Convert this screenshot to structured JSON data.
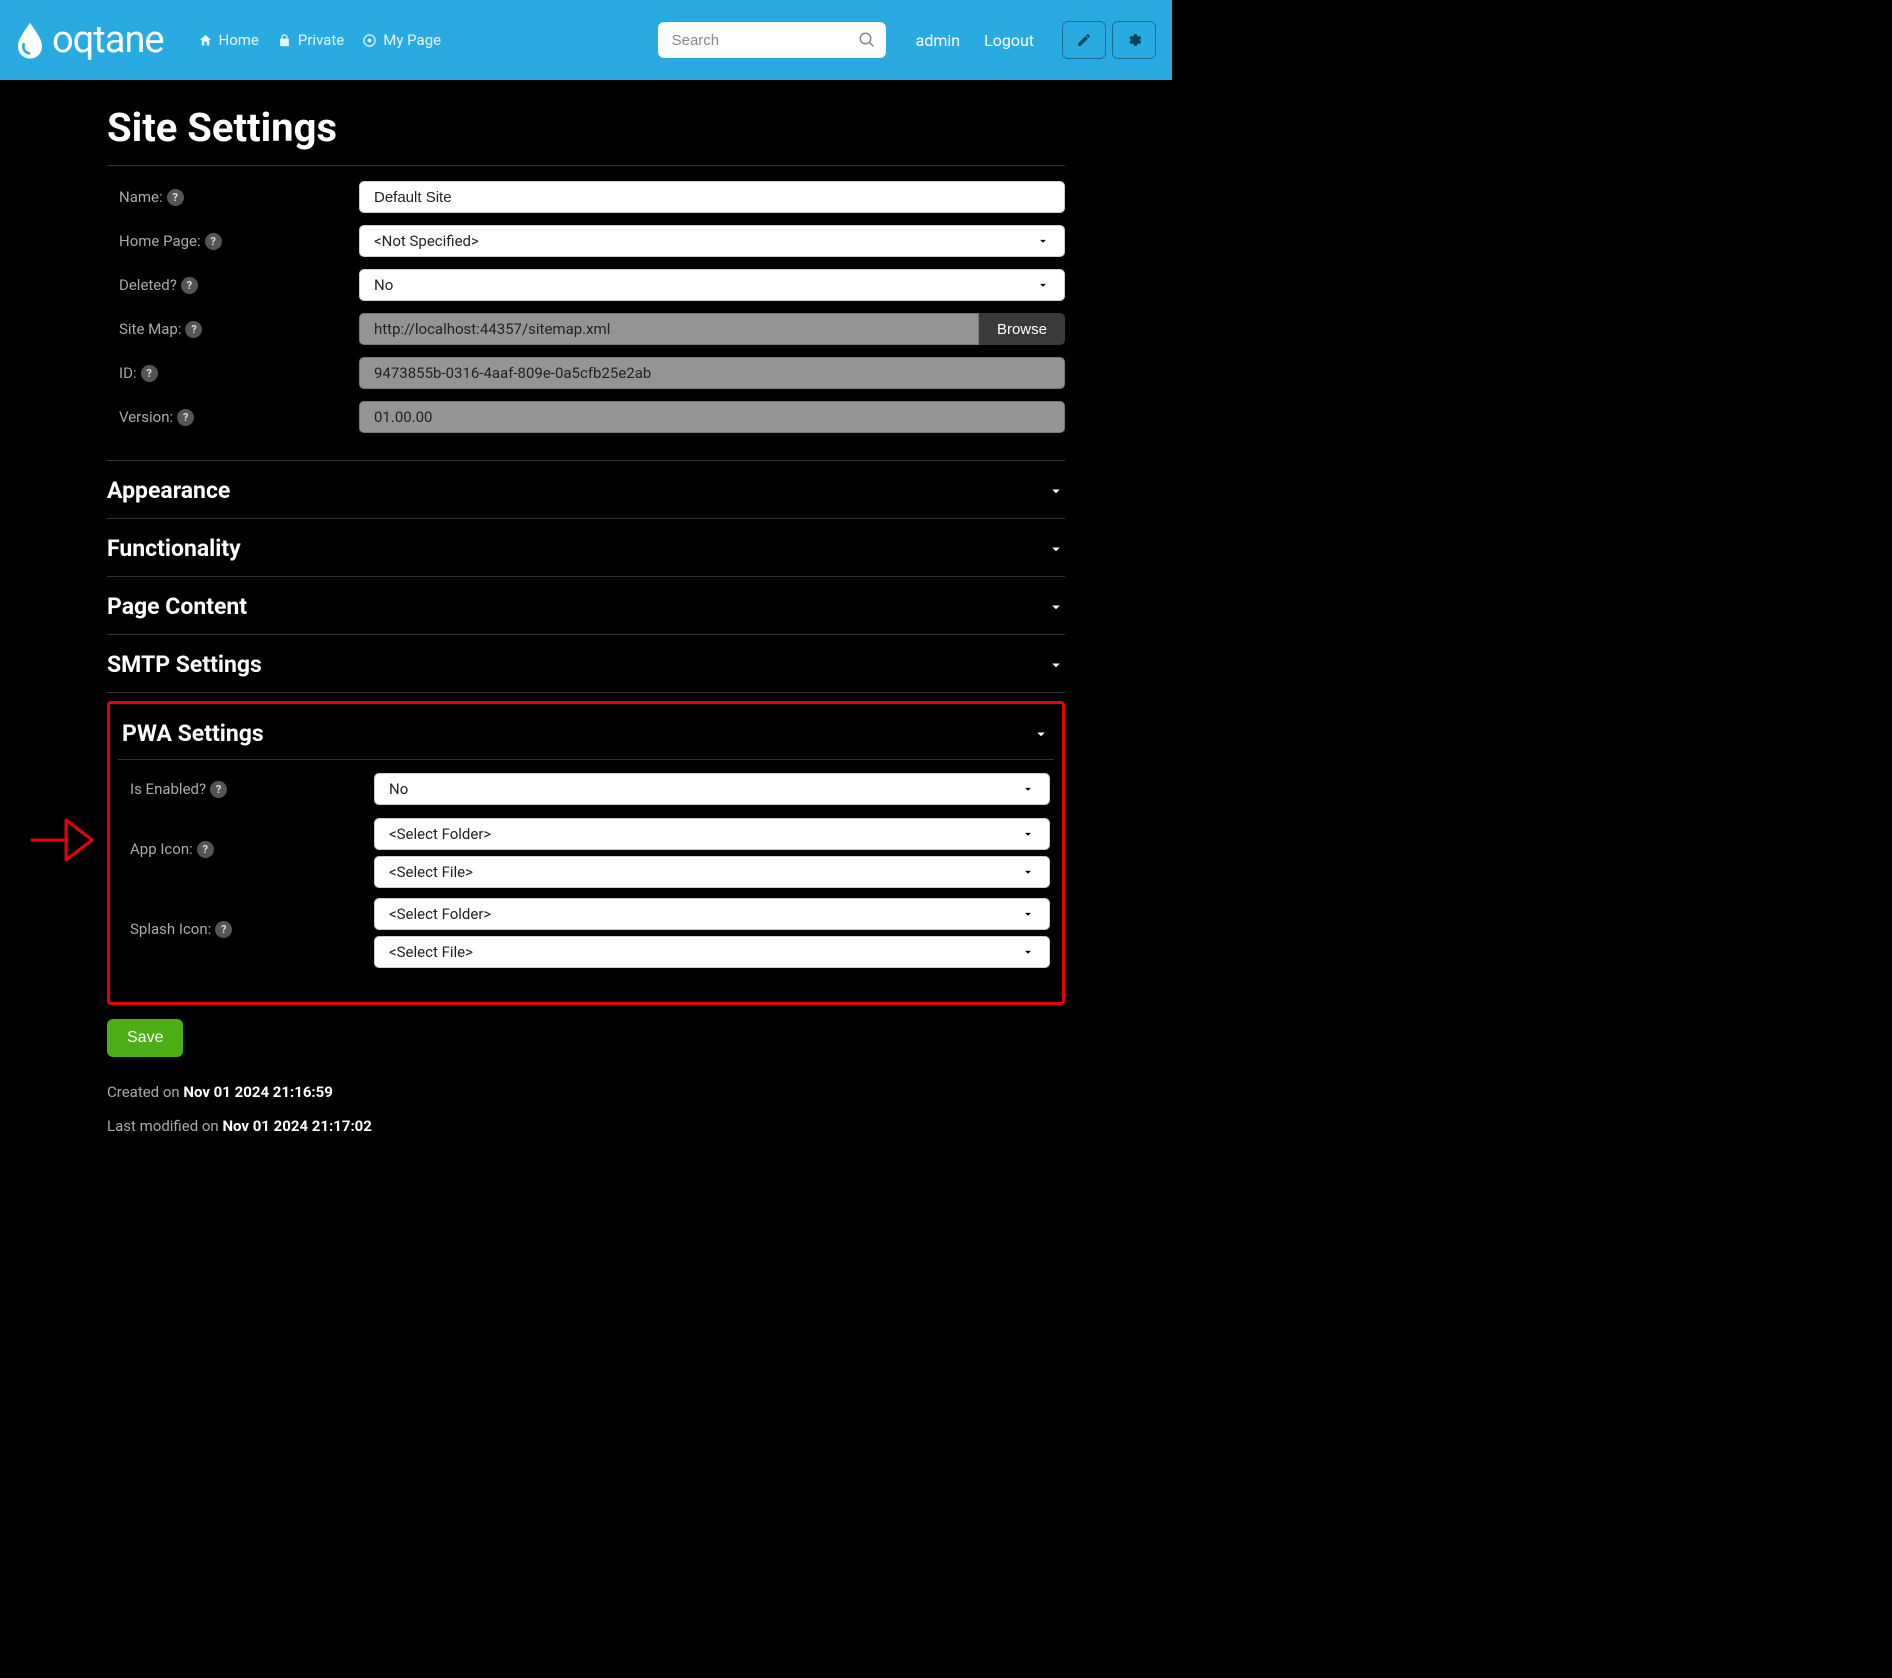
{
  "header": {
    "logo_text": "oqtane",
    "nav": [
      {
        "label": "Home"
      },
      {
        "label": "Private"
      },
      {
        "label": "My Page"
      }
    ],
    "search_placeholder": "Search",
    "admin_label": "admin",
    "logout_label": "Logout"
  },
  "page": {
    "title": "Site Settings"
  },
  "form": {
    "name": {
      "label": "Name:",
      "value": "Default Site"
    },
    "home_page": {
      "label": "Home Page:",
      "value": "<Not Specified>"
    },
    "deleted": {
      "label": "Deleted?",
      "value": "No"
    },
    "site_map": {
      "label": "Site Map:",
      "value": "http://localhost:44357/sitemap.xml",
      "browse": "Browse"
    },
    "id": {
      "label": "ID:",
      "value": "9473855b-0316-4aaf-809e-0a5cfb25e2ab"
    },
    "version": {
      "label": "Version:",
      "value": "01.00.00"
    }
  },
  "accordion": {
    "appearance": "Appearance",
    "functionality": "Functionality",
    "page_content": "Page Content",
    "smtp": "SMTP Settings",
    "pwa": "PWA Settings"
  },
  "pwa": {
    "is_enabled": {
      "label": "Is Enabled?",
      "value": "No"
    },
    "app_icon": {
      "label": "App Icon:",
      "folder": "<Select Folder>",
      "file": "<Select File>"
    },
    "splash_icon": {
      "label": "Splash Icon:",
      "folder": "<Select Folder>",
      "file": "<Select File>"
    }
  },
  "actions": {
    "save": "Save"
  },
  "meta": {
    "created_prefix": "Created on ",
    "created_value": "Nov 01 2024 21:16:59",
    "modified_prefix": "Last modified on ",
    "modified_value": "Nov 01 2024 21:17:02"
  }
}
